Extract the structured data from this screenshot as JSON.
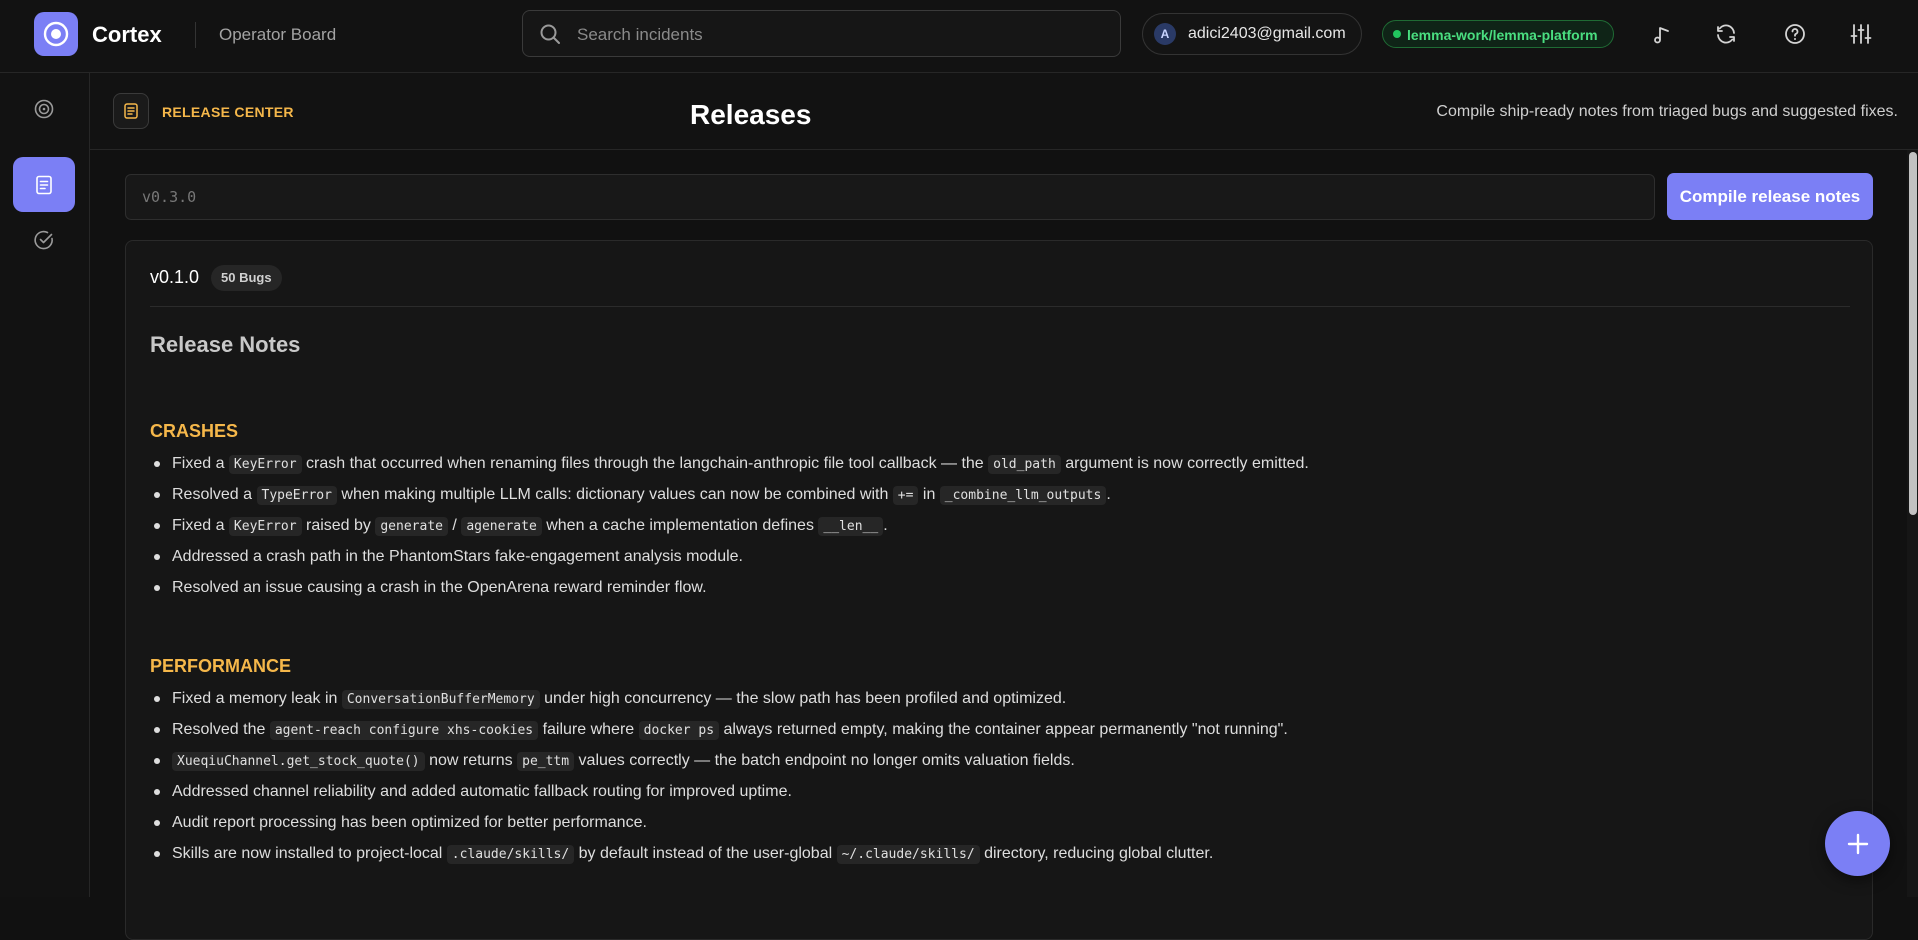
{
  "app": {
    "brand": "Cortex",
    "board_label": "Operator Board",
    "accent_color": "#7b7ff5",
    "logo_icon": "target-ring-icon"
  },
  "search": {
    "placeholder": "Search incidents",
    "value": ""
  },
  "account": {
    "avatar_letter": "A",
    "email": "adici2403@gmail.com"
  },
  "repo": {
    "label": "lemma-work/lemma-platform",
    "status_color": "#22c55e"
  },
  "toolbar_icons": [
    "music-note-icon",
    "refresh-icon",
    "help-icon",
    "settings-sliders-icon"
  ],
  "rail": {
    "items": [
      {
        "icon": "target-icon",
        "active": false
      },
      {
        "icon": "document-icon",
        "active": true
      },
      {
        "icon": "check-circle-icon",
        "active": false
      }
    ]
  },
  "page": {
    "kicker": "RELEASE CENTER",
    "title": "Releases",
    "subtitle": "Compile ship-ready notes from triaged bugs and suggested fixes."
  },
  "compose": {
    "version_placeholder": "v0.3.0",
    "version_value": "",
    "compile_label": "Compile release notes"
  },
  "release": {
    "version": "v0.1.0",
    "bug_badge": "50 Bugs",
    "notes_title": "Release Notes",
    "sections": [
      {
        "title": "CRASHES",
        "items": [
          [
            {
              "t": "Fixed a "
            },
            {
              "c": "KeyError"
            },
            {
              "t": " crash that occurred when renaming files through the langchain-anthropic file tool callback — the "
            },
            {
              "c": "old_path"
            },
            {
              "t": " argument is now correctly emitted."
            }
          ],
          [
            {
              "t": "Resolved a "
            },
            {
              "c": "TypeError"
            },
            {
              "t": " when making multiple LLM calls: dictionary values can now be combined with "
            },
            {
              "c": "+="
            },
            {
              "t": " in "
            },
            {
              "c": "_combine_llm_outputs"
            },
            {
              "t": "."
            }
          ],
          [
            {
              "t": "Fixed a "
            },
            {
              "c": "KeyError"
            },
            {
              "t": " raised by "
            },
            {
              "c": "generate"
            },
            {
              "t": " / "
            },
            {
              "c": "agenerate"
            },
            {
              "t": " when a cache implementation defines "
            },
            {
              "c": "__len__"
            },
            {
              "t": "."
            }
          ],
          [
            {
              "t": "Addressed a crash path in the PhantomStars fake-engagement analysis module."
            }
          ],
          [
            {
              "t": "Resolved an issue causing a crash in the OpenArena reward reminder flow."
            }
          ]
        ]
      },
      {
        "title": "PERFORMANCE",
        "items": [
          [
            {
              "t": "Fixed a memory leak in "
            },
            {
              "c": "ConversationBufferMemory"
            },
            {
              "t": " under high concurrency — the slow path has been profiled and optimized."
            }
          ],
          [
            {
              "t": "Resolved the "
            },
            {
              "c": "agent-reach configure xhs-cookies"
            },
            {
              "t": " failure where "
            },
            {
              "c": "docker ps"
            },
            {
              "t": " always returned empty, making the container appear permanently \"not running\"."
            }
          ],
          [
            {
              "c": "XueqiuChannel.get_stock_quote()"
            },
            {
              "t": " now returns "
            },
            {
              "c": "pe_ttm"
            },
            {
              "t": " values correctly — the batch endpoint no longer omits valuation fields."
            }
          ],
          [
            {
              "t": "Addressed channel reliability and added automatic fallback routing for improved uptime."
            }
          ],
          [
            {
              "t": "Audit report processing has been optimized for better performance."
            }
          ],
          [
            {
              "t": "Skills are now installed to project-local "
            },
            {
              "c": ".claude/skills/"
            },
            {
              "t": " by default instead of the user-global "
            },
            {
              "c": "~/.claude/skills/"
            },
            {
              "t": " directory, reducing global clutter."
            }
          ]
        ]
      }
    ]
  },
  "fab_icon": "plus-icon"
}
